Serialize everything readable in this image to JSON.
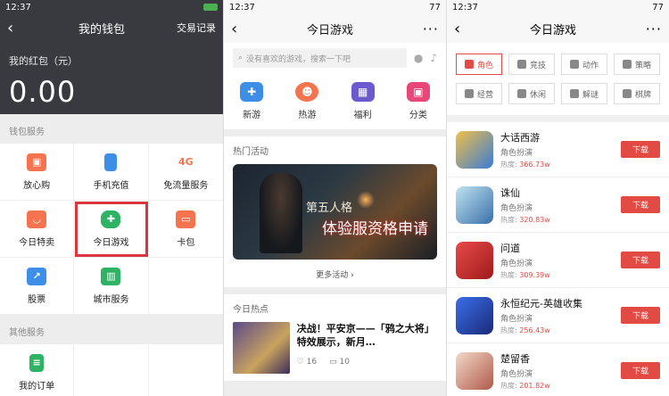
{
  "status": {
    "time": "12:37",
    "battery": "77"
  },
  "wallet": {
    "title": "我的钱包",
    "history": "交易记录",
    "balance_label": "我的红包（元）",
    "balance": "0.00",
    "services_title": "钱包服务",
    "services": [
      {
        "label": "放心购",
        "icon": "shopping-bag-icon",
        "color": "#f5744f"
      },
      {
        "label": "手机充值",
        "icon": "phone-icon",
        "color": "#3d8ee6"
      },
      {
        "label": "免流量服务",
        "icon": "4g-icon",
        "color": "#f5744f",
        "glyph": "4G"
      },
      {
        "label": "今日特卖",
        "icon": "bag-icon",
        "color": "#f5744f"
      },
      {
        "label": "今日游戏",
        "icon": "gamepad-icon",
        "color": "#2eb263"
      },
      {
        "label": "卡包",
        "icon": "ticket-icon",
        "color": "#f5744f"
      },
      {
        "label": "股票",
        "icon": "chart-icon",
        "color": "#3d8ee6"
      },
      {
        "label": "城市服务",
        "icon": "building-icon",
        "color": "#2eb263"
      }
    ],
    "other_title": "其他服务",
    "orders": {
      "label": "我的订单",
      "icon": "order-icon",
      "color": "#2eb263"
    }
  },
  "games_home": {
    "title": "今日游戏",
    "search_placeholder": "没有喜欢的游戏，搜索一下吧",
    "categories": [
      {
        "label": "新游",
        "color": "#3d8ee6"
      },
      {
        "label": "热游",
        "color": "#f5744f"
      },
      {
        "label": "福利",
        "color": "#6a5acd"
      },
      {
        "label": "分类",
        "color": "#e8477a"
      }
    ],
    "hot_activity": "热门活动",
    "banner_logo": "第五人格",
    "banner_text": "体验服资格申请",
    "more": "更多活动 ›",
    "today_hot": "今日热点",
    "news_title": "决战！平安京——「鸦之大将」特效展示，新月…",
    "news_likes": "16",
    "news_comments": "10"
  },
  "games_list": {
    "title": "今日游戏",
    "tags": [
      "角色",
      "竞技",
      "动作",
      "策略",
      "经营",
      "休闲",
      "解谜",
      "棋牌"
    ],
    "items": [
      {
        "name": "大话西游",
        "genre": "角色扮演",
        "heat_label": "热度:",
        "heat": "366.73w",
        "color": "#e6a93a"
      },
      {
        "name": "诛仙",
        "genre": "角色扮演",
        "heat_label": "热度:",
        "heat": "320.83w",
        "color": "#5a8fb8"
      },
      {
        "name": "问道",
        "genre": "角色扮演",
        "heat_label": "热度:",
        "heat": "309.39w",
        "color": "#d93a3a"
      },
      {
        "name": "永恒纪元-英雄收集",
        "genre": "角色扮演",
        "heat_label": "热度:",
        "heat": "256.43w",
        "color": "#3a5ed9"
      },
      {
        "name": "楚留香",
        "genre": "角色扮演",
        "heat_label": "热度:",
        "heat": "201.82w",
        "color": "#c98a8a"
      }
    ],
    "download": "下载"
  }
}
